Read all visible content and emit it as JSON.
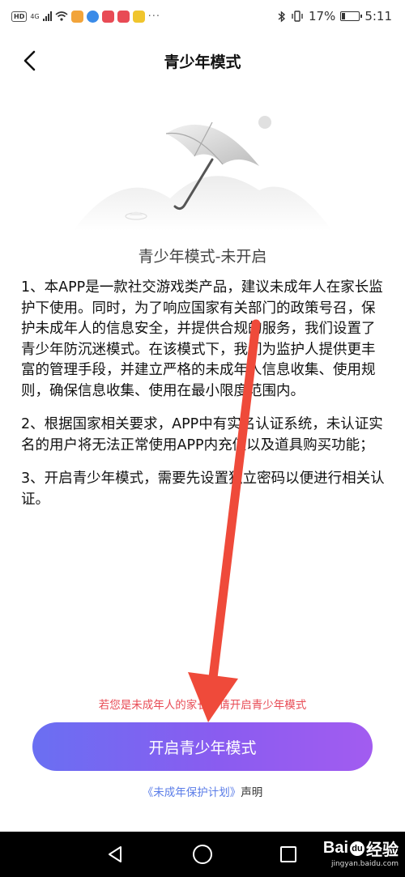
{
  "status_bar": {
    "hd": "HD",
    "network": "4G",
    "battery_percent": "17%",
    "time": "5:11",
    "dots": "···",
    "app_icon_colors": [
      "#f2a43a",
      "#3a8be8",
      "#e84b55",
      "#e84b55",
      "#f0c52d"
    ]
  },
  "header": {
    "title": "青少年模式"
  },
  "status_title": "青少年模式-未开启",
  "terms": {
    "p1": "1、本APP是一款社交游戏类产品，建议未成年人在家长监护下使用。同时，为了响应国家有关部门的政策号召，保护未成年人的信息安全，并提供合规的服务，我们设置了青少年防沉迷模式。在该模式下，我们为监护人提供更丰富的管理手段，并建立严格的未成年人信息收集、使用规则，确保信息收集、使用在最小限度范围内。",
    "p2": "2、根据国家相关要求，APP中有实名认证系统，未认证实名的用户将无法正常使用APP内充值以及道具购买功能；",
    "p3": "3、开启青少年模式，需要先设置独立密码以便进行相关认证。"
  },
  "parent_note": "若您是未成年人的家长，请开启青少年模式",
  "enable_button": "开启青少年模式",
  "statement": {
    "plan_link": "《未成年保护计划》",
    "suffix": "声明"
  },
  "watermark": {
    "logo_text": "Bai",
    "logo_suffix": "经验",
    "paw": "du",
    "url": "jingyan.baidu.com"
  },
  "colors": {
    "accent_start": "#6a6ff2",
    "accent_end": "#a25cf0",
    "link": "#5b7de8",
    "warning": "#e84b55",
    "annotation_arrow": "#ef4a3a"
  }
}
